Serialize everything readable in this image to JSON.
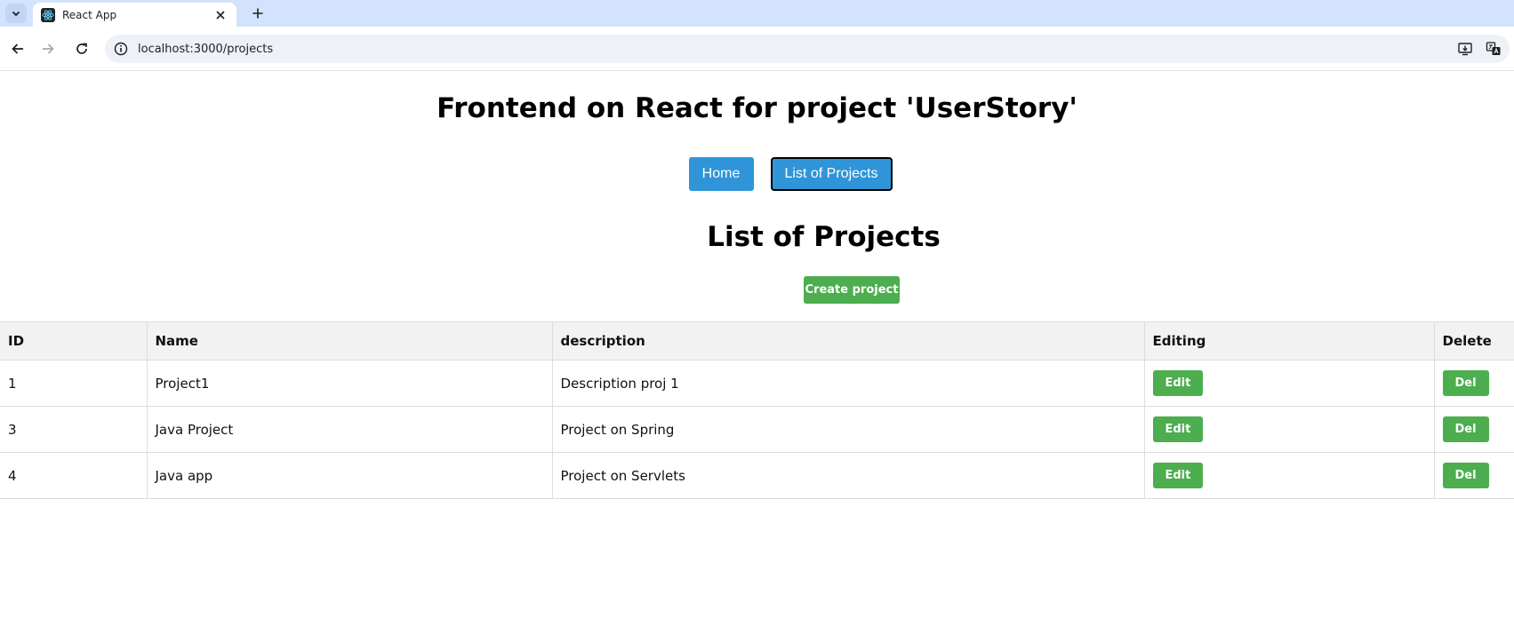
{
  "browser": {
    "tab_title": "React App",
    "url": "localhost:3000/projects"
  },
  "app": {
    "title": "Frontend on React for project 'UserStory'",
    "nav": [
      {
        "label": "Home",
        "active": false
      },
      {
        "label": "List of Projects",
        "active": true
      }
    ],
    "section_title": "List of Projects",
    "create_label": "Create project"
  },
  "table": {
    "headers": [
      "ID",
      "Name",
      "description",
      "Editing",
      "Delete"
    ],
    "rows": [
      {
        "id": "1",
        "name": "Project1",
        "description": "Description proj 1",
        "edit_label": "Edit",
        "delete_label": "Del"
      },
      {
        "id": "3",
        "name": "Java Project",
        "description": "Project on Spring",
        "edit_label": "Edit",
        "delete_label": "Del"
      },
      {
        "id": "4",
        "name": "Java app",
        "description": "Project on Servlets",
        "edit_label": "Edit",
        "delete_label": "Del"
      }
    ]
  },
  "colors": {
    "accent_blue": "#2f95d8",
    "action_green": "#4cae4f",
    "tabstrip": "#d3e3fd"
  }
}
